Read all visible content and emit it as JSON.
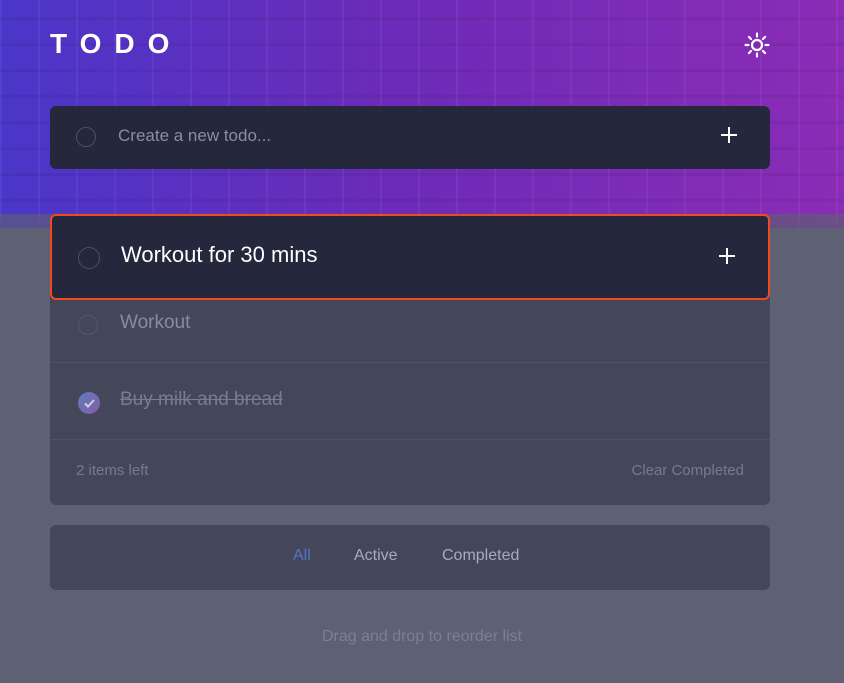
{
  "app": {
    "title": "TODO"
  },
  "icons": {
    "theme_toggle": "sun-icon",
    "add": "plus-icon",
    "check": "check-icon"
  },
  "new_todo": {
    "placeholder": "Create a new todo..."
  },
  "dragging_item": {
    "text": "Workout for 30 mins"
  },
  "todos": [
    {
      "text": "Workout",
      "completed": false
    },
    {
      "text": "Buy milk and bread",
      "completed": true
    }
  ],
  "footer": {
    "items_left": "2 items left",
    "clear_label": "Clear Completed"
  },
  "filters": [
    {
      "label": "All",
      "active": true
    },
    {
      "label": "Active",
      "active": false
    },
    {
      "label": "Completed",
      "active": false
    }
  ],
  "hint": "Drag and drop to reorder list",
  "colors": {
    "accent": "#5573c9",
    "drag_border": "#f04a1f",
    "card_dark": "#25273c",
    "card_muted": "#444659"
  }
}
